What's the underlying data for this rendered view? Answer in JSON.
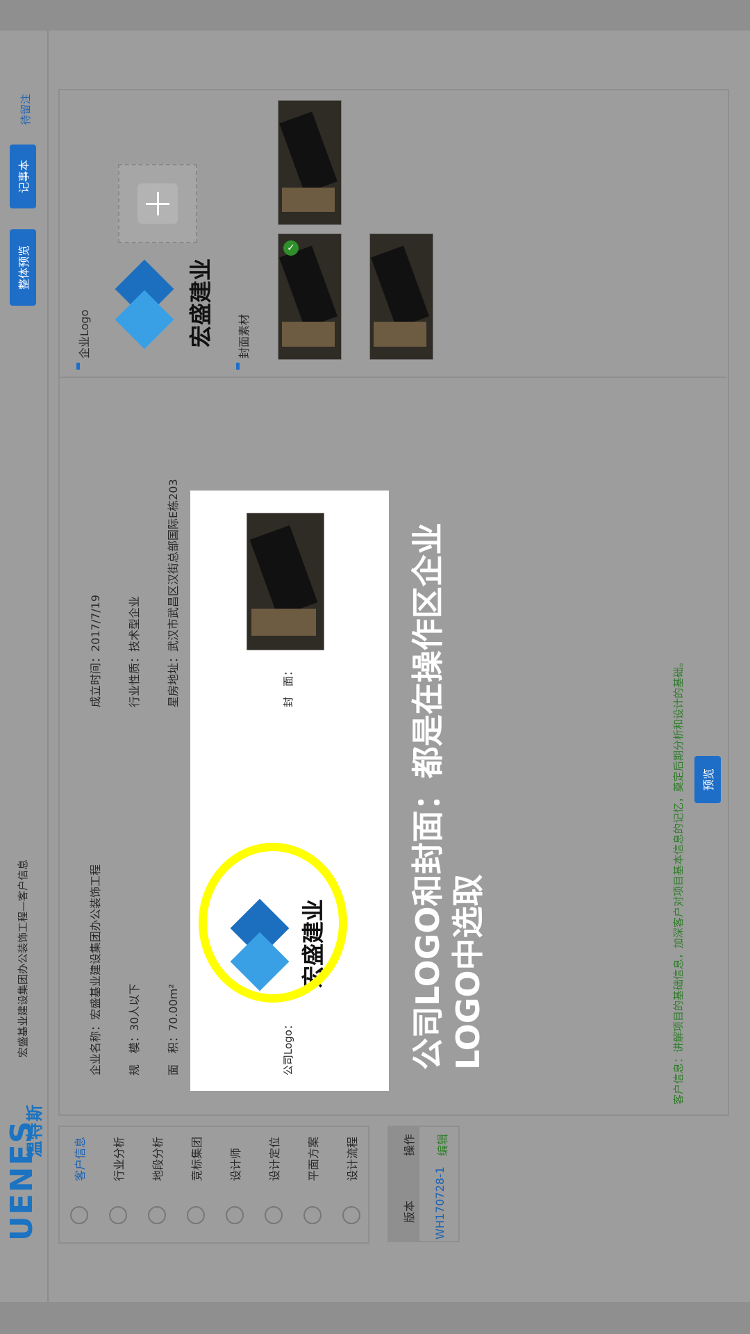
{
  "header": {
    "breadcrumb": "宏盛基业建设集团办公装饰工程—客户信息",
    "buttons": {
      "overall_preview": "整体预览",
      "notebook": "记事本",
      "notes": "待留注"
    }
  },
  "brand": {
    "logo_main": "UENES",
    "logo_sub": "温特斯"
  },
  "sidebar": {
    "items": [
      {
        "label": "客户信息",
        "icon": "users-icon",
        "active": true
      },
      {
        "label": "行业分析",
        "icon": "chart-icon"
      },
      {
        "label": "地段分析",
        "icon": "location-icon"
      },
      {
        "label": "竞标集团",
        "icon": "building-icon"
      },
      {
        "label": "设计师",
        "icon": "designer-icon"
      },
      {
        "label": "设计定位",
        "icon": "document-icon"
      },
      {
        "label": "平面方案",
        "icon": "layout-icon"
      },
      {
        "label": "设计流程",
        "icon": "flow-icon"
      }
    ]
  },
  "version_table": {
    "headers": [
      "版本",
      "操作"
    ],
    "rows": [
      {
        "version": "WH170728-1",
        "action": "编辑"
      }
    ]
  },
  "client_info": {
    "company_name": "企业名称：宏盛基业建设集团办公装饰工程",
    "scale": "规　模：30人以下",
    "area": "面　积：70.00m²",
    "founded": "成立时间：2017/7/19",
    "industry": "行业性质：技术型企业",
    "address": "星房地址：武汉市武昌区汉街总部国际E栋203"
  },
  "preview_card": {
    "logo_label": "公司Logo：",
    "cover_label": "封　面："
  },
  "right_panel": {
    "logo_section_title": "企业Logo",
    "cover_section_title": "封面素材"
  },
  "brand_logo_text": "宏盛建业",
  "overlay": {
    "line1": "公司LOGO和封面：都是在操作区企业",
    "line2": "LOGO中选取"
  },
  "preview_button": "预览",
  "footer_note": "客户信息：讲解项目的基础信息，加深客户对项目基本信息的记忆，奠定后期分析和设计的基础。",
  "colors": {
    "accent": "#1e6ec8",
    "highlight": "#ffff00",
    "note_green": "#2f7d2a"
  }
}
